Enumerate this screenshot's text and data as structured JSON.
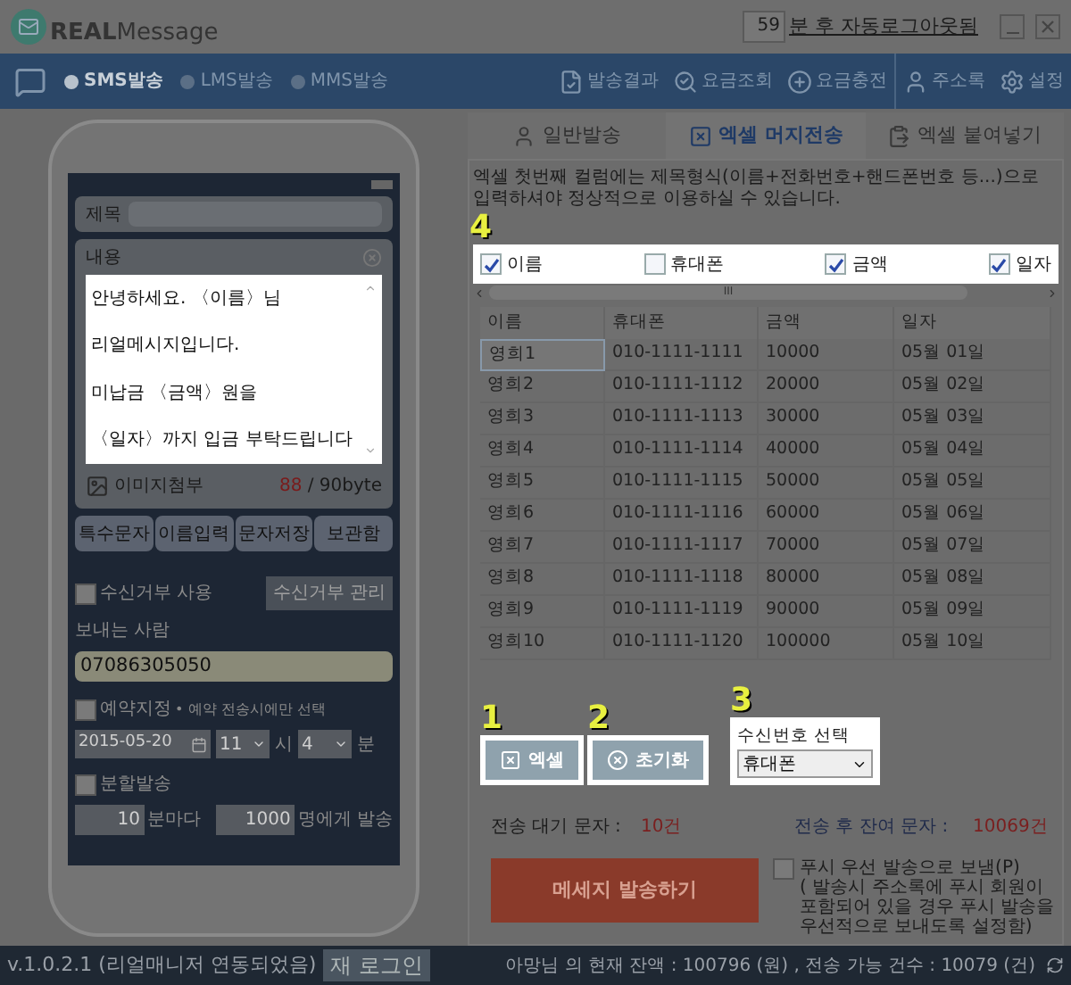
{
  "app": {
    "logo_bold": "REAL",
    "logo_light": "Message",
    "logout_minutes": "59",
    "logout_text": "분 후 자동로그아웃됨"
  },
  "send_types": [
    {
      "label": "SMS발송",
      "selected": true
    },
    {
      "label": "LMS발송",
      "selected": false
    },
    {
      "label": "MMS발송",
      "selected": false
    }
  ],
  "menu": [
    {
      "label": "발송결과",
      "kind": "result"
    },
    {
      "label": "요금조회",
      "kind": "search"
    },
    {
      "label": "요금충전",
      "kind": "charge"
    },
    {
      "label": "주소록",
      "kind": "contacts"
    },
    {
      "label": "설정",
      "kind": "settings"
    }
  ],
  "composer": {
    "subject_label": "제목",
    "content_label": "내용",
    "message_lines": [
      "안녕하세요. 〈이름〉님",
      "리얼메시지입니다.",
      "미납금 〈금액〉원을",
      "〈일자〉까지 입금 부탁드립니다"
    ],
    "attach_label": "이미지첨부",
    "byte_count": "88",
    "byte_limit": "/ 90byte",
    "tools": [
      "특수문자",
      "이름입력",
      "문자저장",
      "보관함"
    ],
    "reject": {
      "label": "수신거부 사용",
      "checked": false,
      "button": "수신거부 관리"
    },
    "sender_label": "보내는 사람",
    "sender_value": "07086305050",
    "reserve": {
      "label": "예약지정",
      "checked": false,
      "hint": "• 예약 전송시에만 선택",
      "date": "2015-05-20",
      "hour": "11",
      "hour_unit": "시",
      "minute": "4",
      "minute_unit": "분"
    },
    "split": {
      "label": "분할발송",
      "checked": false,
      "interval": "10",
      "interval_unit": "분마다",
      "count": "1000",
      "count_unit": "명에게 발송"
    }
  },
  "tabs": [
    {
      "label": "일반발송",
      "kind": "person",
      "selected": false
    },
    {
      "label": "엑셀 머지전송",
      "kind": "excel",
      "selected": true
    },
    {
      "label": "엑셀 붙여넣기",
      "kind": "paste",
      "selected": false
    }
  ],
  "excel": {
    "notice": "엑셀 첫번째 컬럼에는 제목형식(이름+전화번호+핸드폰번호 등...)으로 입력하셔야 정상적으로 이용하실 수 있습니다.",
    "field_badge": "4",
    "fields": [
      {
        "label": "이름",
        "checked": true
      },
      {
        "label": "휴대폰",
        "checked": false
      },
      {
        "label": "금액",
        "checked": true
      },
      {
        "label": "일자",
        "checked": true
      }
    ],
    "scroll_grip": "III",
    "table": {
      "columns": [
        "이름",
        "휴대폰",
        "금액",
        "일자"
      ],
      "rows": [
        {
          "cells": [
            "영희1",
            "010-1111-1111",
            "10000",
            "05월 01일"
          ],
          "selected": true
        },
        {
          "cells": [
            "영희2",
            "010-1111-1112",
            "20000",
            "05월 02일"
          ],
          "selected": false
        },
        {
          "cells": [
            "영희3",
            "010-1111-1113",
            "30000",
            "05월 03일"
          ],
          "selected": false
        },
        {
          "cells": [
            "영희4",
            "010-1111-1114",
            "40000",
            "05월 04일"
          ],
          "selected": false
        },
        {
          "cells": [
            "영희5",
            "010-1111-1115",
            "50000",
            "05월 05일"
          ],
          "selected": false
        },
        {
          "cells": [
            "영희6",
            "010-1111-1116",
            "60000",
            "05월 06일"
          ],
          "selected": false
        },
        {
          "cells": [
            "영희7",
            "010-1111-1117",
            "70000",
            "05월 07일"
          ],
          "selected": false
        },
        {
          "cells": [
            "영희8",
            "010-1111-1118",
            "80000",
            "05월 08일"
          ],
          "selected": false
        },
        {
          "cells": [
            "영희9",
            "010-1111-1119",
            "90000",
            "05월 09일"
          ],
          "selected": false
        },
        {
          "cells": [
            "영희10",
            "010-1111-1120",
            "100000",
            "05월 10일"
          ],
          "selected": false
        }
      ]
    },
    "actions": [
      {
        "badge": "1",
        "label": "엑셀",
        "kind": "excel"
      },
      {
        "badge": "2",
        "label": "초기화",
        "kind": "reset"
      }
    ],
    "receiver": {
      "badge": "3",
      "label": "수신번호 선택",
      "value": "휴대폰"
    }
  },
  "summary": {
    "pending_label": "전송 대기 문자 :",
    "pending": "10건",
    "remain_label": "전송 후 잔여 문자 :",
    "remain": "10069건"
  },
  "send_button": "메세지 발송하기",
  "push": {
    "label": "푸시 우선 발송으로 보냄(P)",
    "note": "( 발송시 주소록에 푸시 회원이 포함되어 있을 경우 푸시 발송을 우선적으로 보내도록 설정함)",
    "checked": false
  },
  "footer": {
    "version": "v.1.0.2.1 (리얼매니저 연동되었음)",
    "relogin": "재 로그인",
    "balance": "아망님 의 현재 잔액 : 100796 (원) , 전송 가능 건수 : 10079 (건)"
  }
}
